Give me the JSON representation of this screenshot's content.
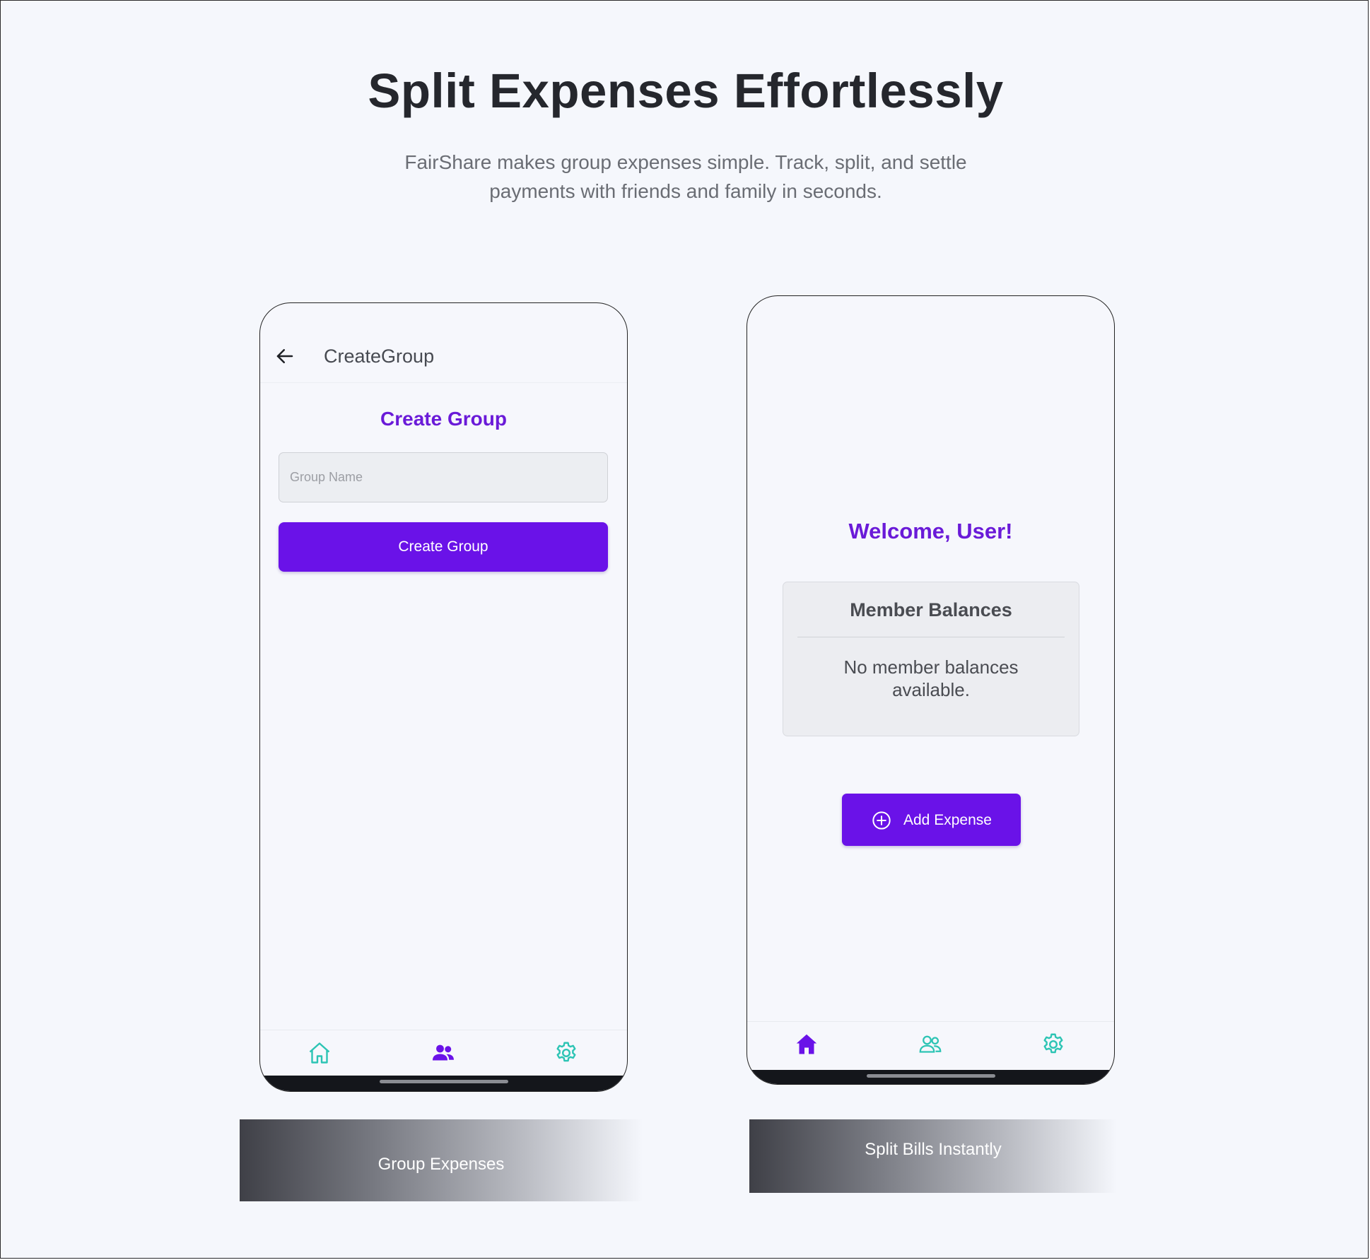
{
  "hero": {
    "title": "Split Expenses Effortlessly",
    "subtitle_line1": "FairShare makes group expenses simple. Track, split, and settle",
    "subtitle_line2": "payments with friends and family in seconds."
  },
  "create_group_screen": {
    "header_title": "CreateGroup",
    "form_title": "Create Group",
    "group_name_placeholder": "Group Name",
    "group_name_value": "",
    "submit_label": "Create Group",
    "active_tab": "groups"
  },
  "home_screen": {
    "welcome": "Welcome, User!",
    "balances_title": "Member Balances",
    "balances_empty": "No member balances available.",
    "add_expense_label": "Add Expense",
    "active_tab": "home"
  },
  "tabs": [
    {
      "name": "home",
      "icon": "home-icon"
    },
    {
      "name": "groups",
      "icon": "users-icon"
    },
    {
      "name": "settings",
      "icon": "gear-icon"
    }
  ],
  "captions": {
    "left": "Group Expenses",
    "right": "Split Bills Instantly"
  },
  "colors": {
    "accent": "#6a12e8",
    "accent_text": "#6a1ad8",
    "tab_inactive": "#2cc4b4",
    "background": "#f5f7fc"
  }
}
